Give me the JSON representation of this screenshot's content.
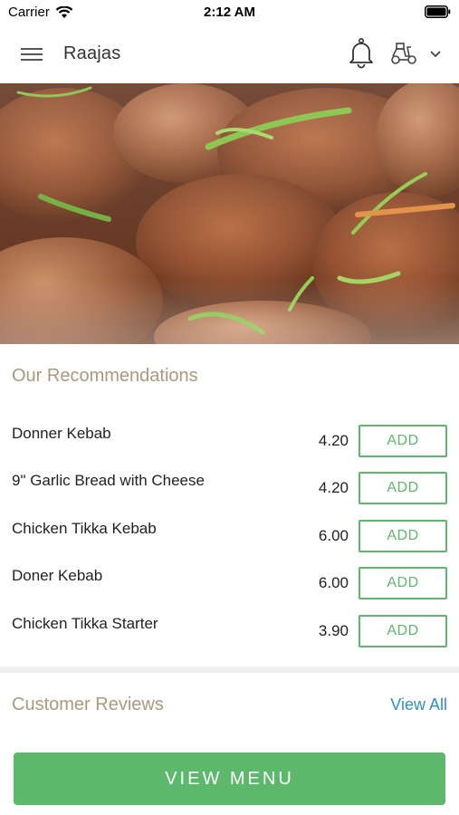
{
  "status_bar": {
    "carrier": "Carrier",
    "time": "2:12 AM"
  },
  "header": {
    "title": "Raajas",
    "icons": [
      "hamburger-menu-icon",
      "bell-icon",
      "scooter-icon",
      "chevron-down-icon"
    ]
  },
  "recommendations": {
    "title": "Our Recommendations",
    "add_label": "ADD",
    "items": [
      {
        "name": "Donner Kebab",
        "price": "4.20"
      },
      {
        "name": "9\" Garlic Bread with Cheese",
        "price": "4.20"
      },
      {
        "name": "Chicken Tikka Kebab",
        "price": "6.00"
      },
      {
        "name": "Doner Kebab",
        "price": "6.00"
      },
      {
        "name": "Chicken Tikka Starter",
        "price": "3.90"
      }
    ]
  },
  "reviews": {
    "title": "Customer Reviews",
    "view_all_label": "View All"
  },
  "footer": {
    "view_menu_label": "VIEW MENU"
  },
  "colors": {
    "accent_green": "#5cb86b",
    "section_title": "#a99a7c",
    "link_blue": "#2f8fc8"
  }
}
